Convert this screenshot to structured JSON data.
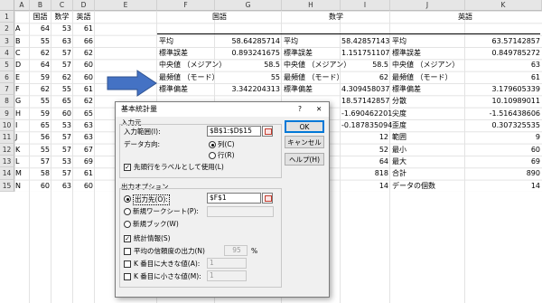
{
  "columns": [
    "A",
    "B",
    "C",
    "D",
    "E",
    "F",
    "G",
    "H",
    "I",
    "J",
    "K"
  ],
  "rows": [
    "1",
    "2",
    "3",
    "4",
    "5",
    "6",
    "7",
    "8",
    "9",
    "10",
    "11",
    "12",
    "13",
    "14",
    "15"
  ],
  "headers": {
    "b": "国語",
    "c": "数学",
    "d": "英語",
    "f": "国語",
    "h": "数学",
    "j": "英語"
  },
  "data_rows": [
    [
      "A",
      "64",
      "53",
      "61"
    ],
    [
      "B",
      "55",
      "63",
      "66"
    ],
    [
      "C",
      "62",
      "57",
      "62"
    ],
    [
      "D",
      "64",
      "57",
      "60"
    ],
    [
      "E",
      "59",
      "62",
      "60"
    ],
    [
      "F",
      "62",
      "55",
      "61"
    ],
    [
      "G",
      "55",
      "65",
      "62"
    ],
    [
      "H",
      "59",
      "60",
      "65"
    ],
    [
      "I",
      "65",
      "53",
      "63"
    ],
    [
      "J",
      "56",
      "57",
      "63"
    ],
    [
      "K",
      "55",
      "57",
      "67"
    ],
    [
      "L",
      "57",
      "53",
      "69"
    ],
    [
      "M",
      "58",
      "57",
      "61"
    ],
    [
      "N",
      "60",
      "63",
      "60"
    ]
  ],
  "stats": {
    "f_labels": [
      "平均",
      "標準誤差",
      "中央値 （メジアン）",
      "最頻値 （モード）",
      "標準偏差"
    ],
    "g_values": [
      "58.64285714",
      "0.893241675",
      "58.5",
      "55",
      "3.342204313"
    ],
    "h_labels": [
      "平均",
      "標準誤差",
      "中央値 （メジアン）",
      "最頻値 （モード）",
      "標準偏差"
    ],
    "i_values": [
      "58.42857143",
      "1.151751107",
      "58.5",
      "62",
      "4.309458037",
      "18.57142857",
      "-1.690462201",
      "-0.187835094",
      "12",
      "52",
      "64",
      "818",
      "14"
    ],
    "j_labels": [
      "平均",
      "標準誤差",
      "中央値 （メジアン）",
      "最頻値 （モード）",
      "標準偏差",
      "分散",
      "尖度",
      "歪度",
      "範囲",
      "最小",
      "最大",
      "合計",
      "データの個数"
    ],
    "k_values": [
      "63.57142857",
      "0.849785272",
      "63",
      "61",
      "3.179605339",
      "10.10989011",
      "-1.516438606",
      "0.307325535",
      "9",
      "60",
      "69",
      "890",
      "14"
    ]
  },
  "dialog": {
    "title": "基本統計量",
    "help_icon": "?",
    "close_icon": "✕",
    "input_section": "入力元",
    "input_range_label": "入力範囲(I):",
    "input_range_value": "$B$1:$D$15",
    "direction_label": "データ方向:",
    "radio_column": "列(C)",
    "radio_row": "行(R)",
    "first_row_label": "先頭行をラベルとして使用(L)",
    "output_section": "出力オプション",
    "output_dest_label": "出力先(O):",
    "output_dest_value": "$F$1",
    "new_sheet_label": "新規ワークシート(P):",
    "new_book_label": "新規ブック(W)",
    "summary_stats_label": "統計情報(S)",
    "confidence_label": "平均の信頼度の出力(N)",
    "confidence_value": "95",
    "confidence_unit": "%",
    "kth_largest_label": "K 番目に大きな値(A):",
    "kth_largest_value": "1",
    "kth_smallest_label": "K 番目に小さな値(M):",
    "kth_smallest_value": "1",
    "ok": "OK",
    "cancel": "キャンセル",
    "help": "ヘルプ(H)"
  }
}
